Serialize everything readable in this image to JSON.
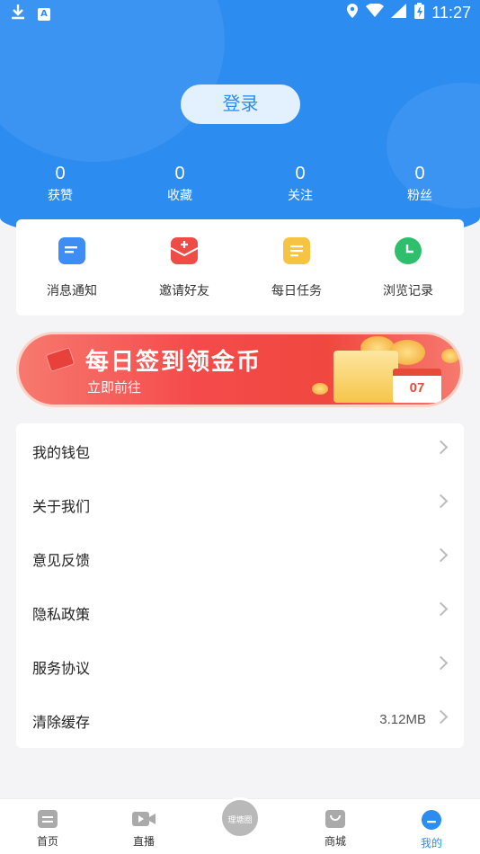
{
  "statusbar": {
    "time": "11:27"
  },
  "header": {
    "login_label": "登录"
  },
  "stats": [
    {
      "value": "0",
      "label": "获赞"
    },
    {
      "value": "0",
      "label": "收藏"
    },
    {
      "value": "0",
      "label": "关注"
    },
    {
      "value": "0",
      "label": "粉丝"
    }
  ],
  "quick": [
    {
      "label": "消息通知",
      "icon": "message-icon",
      "color": "#3d8df5"
    },
    {
      "label": "邀请好友",
      "icon": "invite-envelope-icon",
      "color": "#ef4c47"
    },
    {
      "label": "每日任务",
      "icon": "task-list-icon",
      "color": "#f6c342"
    },
    {
      "label": "浏览记录",
      "icon": "clock-history-icon",
      "color": "#2ebf6d"
    }
  ],
  "banner": {
    "title": "每日签到领金币",
    "subtitle": "立即前往",
    "calendar_day": "07"
  },
  "menu": [
    {
      "label": "我的钱包",
      "value": ""
    },
    {
      "label": "关于我们",
      "value": ""
    },
    {
      "label": "意见反馈",
      "value": ""
    },
    {
      "label": "隐私政策",
      "value": ""
    },
    {
      "label": "服务协议",
      "value": ""
    },
    {
      "label": "清除缓存",
      "value": "3.12MB"
    }
  ],
  "tabbar": {
    "home": "首页",
    "live": "直播",
    "center": "理塘圈",
    "shop": "商城",
    "mine": "我的"
  },
  "colors": {
    "primary": "#2d8cf0"
  }
}
